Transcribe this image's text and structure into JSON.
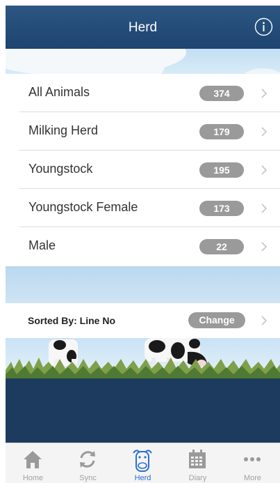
{
  "navbar": {
    "title": "Herd",
    "info_icon": "info-icon"
  },
  "list": [
    {
      "label": "All Animals",
      "count": "374"
    },
    {
      "label": "Milking Herd",
      "count": "179"
    },
    {
      "label": "Youngstock",
      "count": "195"
    },
    {
      "label": "Youngstock Female",
      "count": "173"
    },
    {
      "label": "Male",
      "count": "22"
    }
  ],
  "sort": {
    "label": "Sorted By: Line No",
    "button": "Change"
  },
  "tabs": [
    {
      "label": "Home",
      "icon": "home-icon"
    },
    {
      "label": "Sync",
      "icon": "sync-icon"
    },
    {
      "label": "Herd",
      "icon": "cow-icon",
      "active": true
    },
    {
      "label": "Diary",
      "icon": "calendar-icon"
    },
    {
      "label": "More",
      "icon": "more-icon"
    }
  ],
  "colors": {
    "nav": "#1e4470",
    "accent": "#2a6fd6",
    "badge": "#9a9a9a"
  }
}
